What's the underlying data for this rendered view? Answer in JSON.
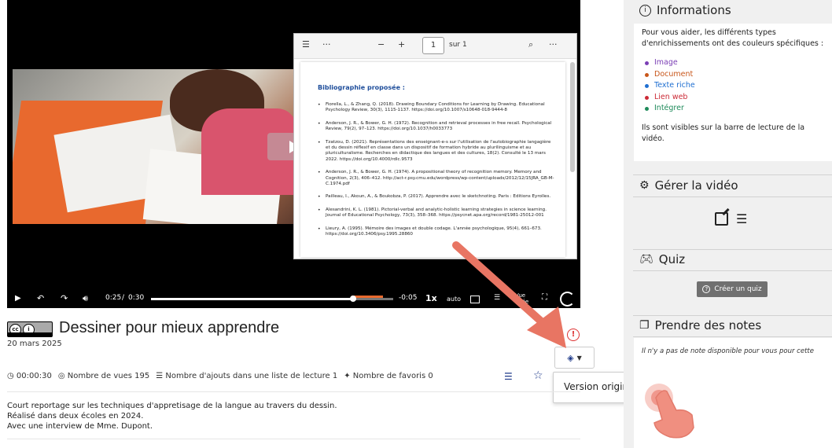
{
  "player": {
    "pdf": {
      "page_input": "1",
      "page_of": "sur 1",
      "heading": "Bibliographie proposée :",
      "entries": [
        "Fiorella, L., & Zhang, Q. (2018). Drawing Boundary Conditions for Learning by Drawing. Educational Psychology Review, 30(3), 1115-1137. https://doi.org/10.1007/s10648-018-9444-8",
        "Anderson, J. R., & Bower, G. H. (1972). Recognition and retrieval processes in free recall. Psychological Review, 79(2), 97–123. https://doi.org/10.1037/h0033773",
        "Tzatzou, D. (2021). Représentations des enseignant-e-s sur l'utilisation de l'autobiographie langagière et du dessin réflexif en classe dans un dispositif de formation hybride au plurilinguisme et au pluriculturalisme. Recherches en didactique des langues et des cultures, 18(2). Consulté le 13 mars 2022. https://doi.org/10.4000/rdlc.9573",
        "Anderson, J. R., & Bower, G. H. (1974). A propositional theory of recognition memory. Memory and Cognition, 2(3), 406–412. http://act-r.psy.cmu.edu/wordpress/wp-content/uploads/2012/12/15JRA_GB-M-C.1974.pdf",
        "Pailleau, I., Akoun, A., & Boukobza, P. (2017). Apprendre avec le sketchnoting. Paris : Editions Eyrolles.",
        "Alesandrini, K. L. (1981). Pictorial-verbal and analytic-holistic learning strategies in science learning. Journal of Educational Psychology, 73(3), 358–368. https://psycnet.apa.org/record/1981-25012-001",
        "Lieury, A. (1995). Mémoire des images et double codage. L'année psychologique, 95(4), 661–673. https://doi.org/10.3406/psy.1995.28860"
      ]
    },
    "controls": {
      "current_time": "0:25",
      "separator": "/",
      "duration": "0:30",
      "remaining": "-0:05",
      "speed": "1x",
      "quality": "auto",
      "view_mode": "Vue agée",
      "progress": 0.833
    }
  },
  "video": {
    "title": "Dessiner pour mieux apprendre",
    "date": "20 mars 2025",
    "license": "CC BY",
    "duration": "00:00:30",
    "views": "Nombre de vues 195",
    "playlist_adds": "Nombre d'ajouts dans une liste de lecture 1",
    "favorites": "Nombre de favoris 0",
    "description": [
      "Court reportage sur les techniques d'appretisage de la langue au travers du dessin.",
      "Réalisé dans deux écoles en 2024.",
      "Avec une interview de Mme. Dupont."
    ]
  },
  "version_menu": {
    "option": "Version originale"
  },
  "sidebar": {
    "info": {
      "title": "Informations",
      "intro": "Pour vous aider, les différents types d'enrichissements ont des couleurs spécifiques :",
      "legend": [
        {
          "label": "Image",
          "color": "#7b3fb5"
        },
        {
          "label": "Document",
          "color": "#c8561a"
        },
        {
          "label": "Texte riche",
          "color": "#1f6fd1"
        },
        {
          "label": "Lien web",
          "color": "#cc2a36"
        },
        {
          "label": "Intégrer",
          "color": "#1e8a5a"
        }
      ],
      "outro": "Ils sont visibles sur la barre de lecture de la vidéo."
    },
    "manage": {
      "title": "Gérer la vidéo"
    },
    "quiz": {
      "title": "Quiz",
      "button": "Créer un quiz"
    },
    "notes": {
      "title": "Prendre des notes",
      "empty": "Il n'y a pas de note disponible pour vous pour cette"
    }
  }
}
